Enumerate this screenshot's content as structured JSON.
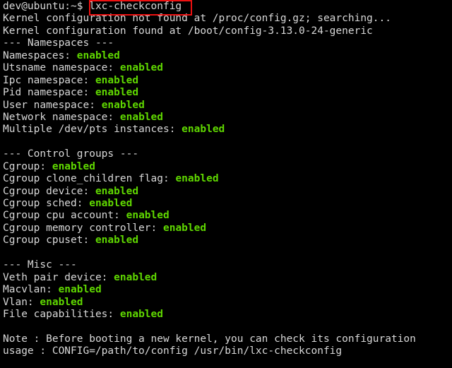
{
  "terminal": {
    "title": "lxc-checkconfig terminal output",
    "colors": {
      "background": "#000000",
      "foreground": "#d8d8d8",
      "enabled_green": "#5fd700",
      "highlight_box": "#ee1111"
    },
    "prompt": {
      "user": "dev",
      "host": "ubuntu",
      "path": "~",
      "symbol": "$",
      "full": "dev@ubuntu:~$"
    },
    "command": "lxc-checkconfig",
    "highlight": {
      "target": "lxc-checkconfig",
      "color": "#ee1111"
    },
    "lines": [
      {
        "type": "prompt",
        "prompt": "dev@ubuntu:~$ ",
        "command": "lxc-checkconfig"
      },
      {
        "type": "text",
        "text": "Kernel configuration not found at /proc/config.gz; searching..."
      },
      {
        "type": "text",
        "text": "Kernel configuration found at /boot/config-3.13.0-24-generic"
      },
      {
        "type": "text",
        "text": "--- Namespaces ---"
      },
      {
        "type": "kv",
        "label": "Namespaces: ",
        "value": "enabled"
      },
      {
        "type": "kv",
        "label": "Utsname namespace: ",
        "value": "enabled"
      },
      {
        "type": "kv",
        "label": "Ipc namespace: ",
        "value": "enabled"
      },
      {
        "type": "kv",
        "label": "Pid namespace: ",
        "value": "enabled"
      },
      {
        "type": "kv",
        "label": "User namespace: ",
        "value": "enabled"
      },
      {
        "type": "kv",
        "label": "Network namespace: ",
        "value": "enabled"
      },
      {
        "type": "kv",
        "label": "Multiple /dev/pts instances: ",
        "value": "enabled"
      },
      {
        "type": "blank",
        "text": ""
      },
      {
        "type": "text",
        "text": "--- Control groups ---"
      },
      {
        "type": "kv",
        "label": "Cgroup: ",
        "value": "enabled"
      },
      {
        "type": "kv",
        "label": "Cgroup clone_children flag: ",
        "value": "enabled"
      },
      {
        "type": "kv",
        "label": "Cgroup device: ",
        "value": "enabled"
      },
      {
        "type": "kv",
        "label": "Cgroup sched: ",
        "value": "enabled"
      },
      {
        "type": "kv",
        "label": "Cgroup cpu account: ",
        "value": "enabled"
      },
      {
        "type": "kv",
        "label": "Cgroup memory controller: ",
        "value": "enabled"
      },
      {
        "type": "kv",
        "label": "Cgroup cpuset: ",
        "value": "enabled"
      },
      {
        "type": "blank",
        "text": ""
      },
      {
        "type": "text",
        "text": "--- Misc ---"
      },
      {
        "type": "kv",
        "label": "Veth pair device: ",
        "value": "enabled"
      },
      {
        "type": "kv",
        "label": "Macvlan: ",
        "value": "enabled"
      },
      {
        "type": "kv",
        "label": "Vlan: ",
        "value": "enabled"
      },
      {
        "type": "kv",
        "label": "File capabilities: ",
        "value": "enabled"
      },
      {
        "type": "blank",
        "text": ""
      },
      {
        "type": "text",
        "text": "Note : Before booting a new kernel, you can check its configuration"
      },
      {
        "type": "text",
        "text": "usage : CONFIG=/path/to/config /usr/bin/lxc-checkconfig"
      }
    ]
  }
}
